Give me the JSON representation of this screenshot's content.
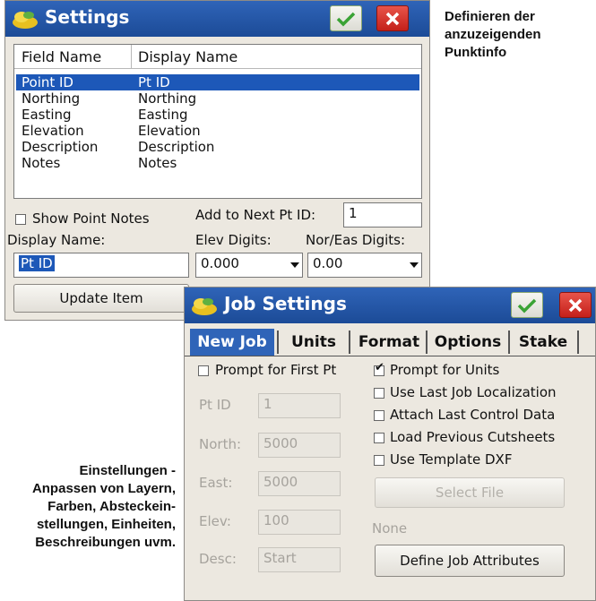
{
  "caption_top": [
    "Definieren der",
    "anzuzeigenden",
    "Punktinfo"
  ],
  "caption_bottom": [
    "Einstellungen -",
    "Anpassen von Layern,",
    "Farben, Absteckein-",
    "stellungen, Einheiten,",
    "Beschreibungen uvm."
  ],
  "settings": {
    "title": "Settings",
    "col_field": "Field Name",
    "col_display": "Display Name",
    "rows": [
      {
        "field": "Point ID",
        "display": "Pt ID"
      },
      {
        "field": "Northing",
        "display": "Northing"
      },
      {
        "field": "Easting",
        "display": "Easting"
      },
      {
        "field": "Elevation",
        "display": "Elevation"
      },
      {
        "field": "Description",
        "display": "Description"
      },
      {
        "field": "Notes",
        "display": "Notes"
      }
    ],
    "show_point_notes": "Show Point Notes",
    "add_next_label": "Add to Next Pt ID:",
    "add_next_value": "1",
    "display_name_label": "Display Name:",
    "display_name_value": "Pt ID",
    "elev_digits_label": "Elev Digits:",
    "elev_digits_value": "0.000",
    "nor_eas_label": "Nor/Eas Digits:",
    "nor_eas_value": "0.00",
    "update_button": "Update Item"
  },
  "job": {
    "title": "Job Settings",
    "tabs": [
      "New Job",
      "Units",
      "Format",
      "Options",
      "Stake"
    ],
    "prompt_first_pt": "Prompt for First Pt",
    "prompt_units": "Prompt for Units",
    "use_last_job_loc": "Use Last Job Localization",
    "attach_last_ctrl": "Attach Last Control Data",
    "load_prev_cutsheets": "Load Previous Cutsheets",
    "use_template_dxf": "Use Template DXF",
    "select_file": "Select File",
    "none_label": "None",
    "define_attributes": "Define Job Attributes",
    "fields": [
      {
        "label": "Pt ID",
        "value": "1"
      },
      {
        "label": "North:",
        "value": "5000"
      },
      {
        "label": "East:",
        "value": "5000"
      },
      {
        "label": "Elev:",
        "value": "100"
      },
      {
        "label": "Desc:",
        "value": "Start"
      }
    ]
  },
  "colors": {
    "titlebar": "#1f4f9c",
    "selection": "#1d58b8",
    "ok_green": "#3aa335",
    "close_red": "#c8261e"
  }
}
